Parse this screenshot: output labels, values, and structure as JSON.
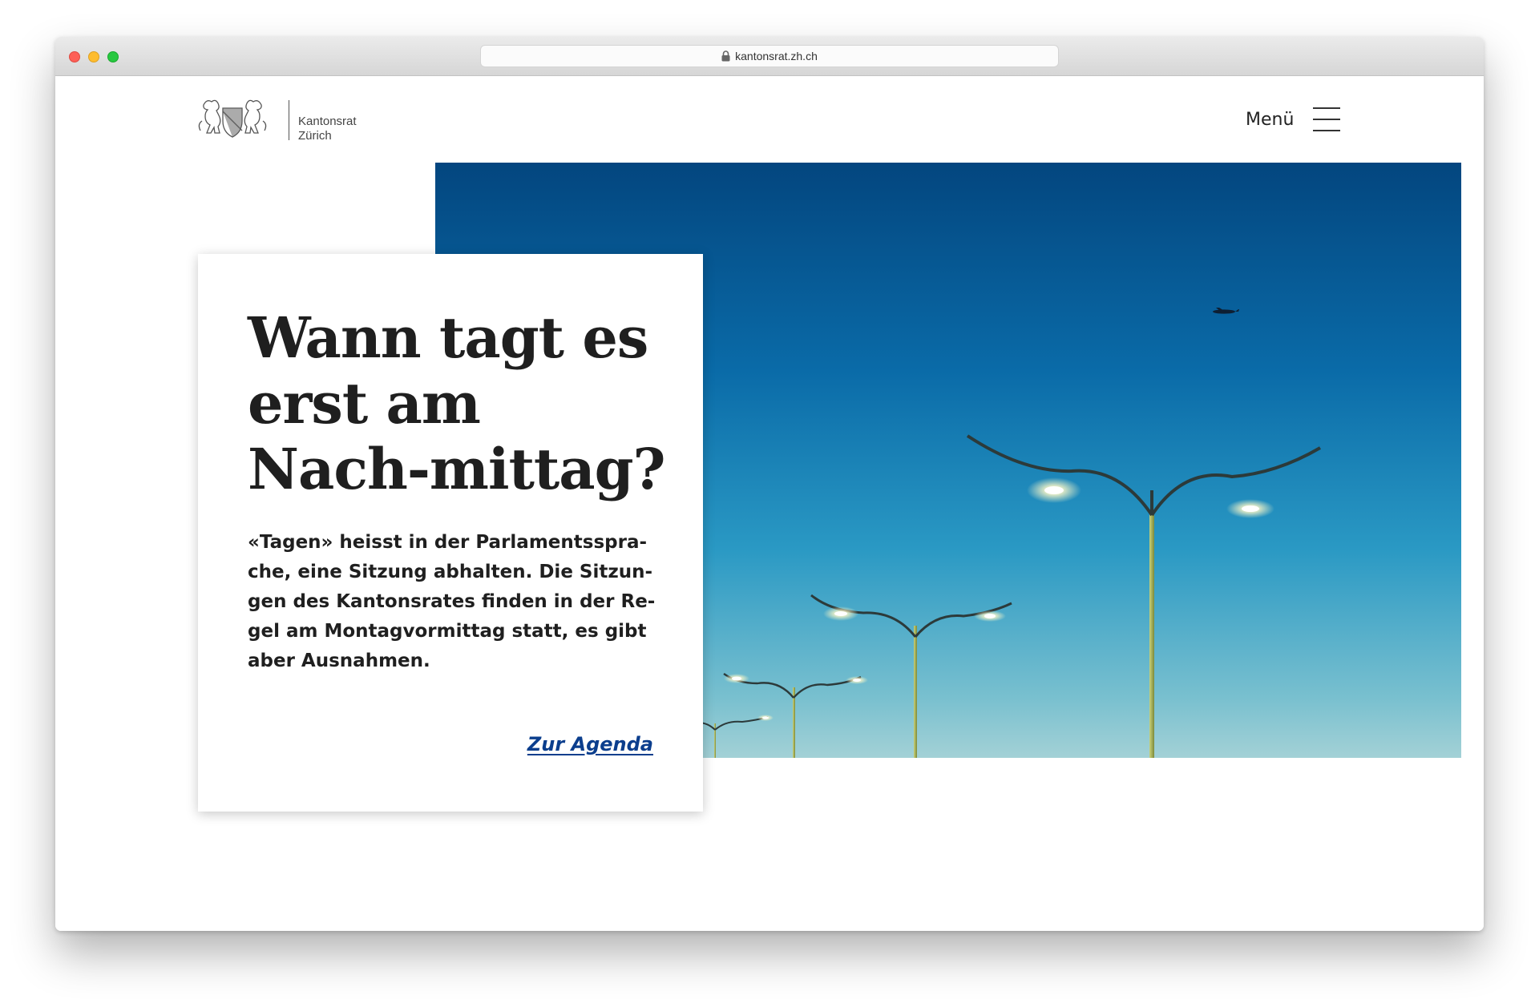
{
  "browser": {
    "url": "kantonsrat.zh.ch"
  },
  "header": {
    "logo_line1": "Kantonsrat",
    "logo_line2": "Zürich",
    "menu_label": "Menü"
  },
  "hero": {
    "title": "Wann tagt es erst am Nach-mittag?",
    "text": "«Tagen» heisst in der Parlamentsspra-che, eine Sitzung abhalten. Die Sitzun-gen des Kantonsrates finden in der Re-gel am Montagvormittag statt, es gibt aber Ausnahmen.",
    "link_label": "Zur Agenda"
  },
  "colors": {
    "link": "#0b3e8d",
    "text": "#1f1f1f",
    "sky_top": "#03467f",
    "sky_bottom": "#a3d1d6"
  }
}
